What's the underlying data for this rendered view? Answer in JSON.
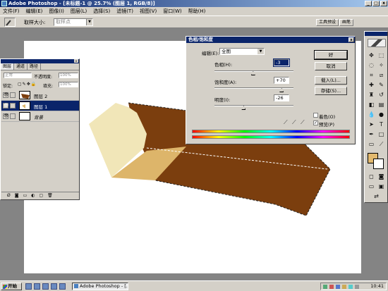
{
  "window": {
    "title": "Adobe Photoshop - [未标题-1 @ 25.7% (图层 1, RGB/8)]"
  },
  "menu": [
    "文件(F)",
    "编辑(E)",
    "图像(I)",
    "图层(L)",
    "选择(S)",
    "滤镜(T)",
    "视图(V)",
    "窗口(W)",
    "帮助(H)"
  ],
  "options": {
    "sample_size_label": "取样大小:",
    "sample_size_value": "取样点",
    "well_tabs": [
      "工具预设",
      "画笔"
    ]
  },
  "layers_panel": {
    "tabs": [
      "图层",
      "通道",
      "路径"
    ],
    "blend_mode": "正常",
    "opacity_label": "不透明度:",
    "opacity_value": "100%",
    "lock_label": "锁定:",
    "fill_label": "填充:",
    "fill_value": "100%",
    "layers": [
      {
        "name": "图层 2",
        "selected": false
      },
      {
        "name": "图层 1",
        "selected": true
      },
      {
        "name": "背景",
        "selected": false
      }
    ]
  },
  "dialog": {
    "title": "色相/饱和度",
    "edit_label": "编辑(E):",
    "edit_value": "全图",
    "hue_label": "色相(H):",
    "hue_value": "-3",
    "saturation_label": "饱和度(A):",
    "saturation_value": "+70",
    "lightness_label": "明度(I):",
    "lightness_value": "-26",
    "buttons": {
      "ok": "好",
      "cancel": "取消",
      "load": "载入(L)...",
      "save": "存储(S)..."
    },
    "colorize_label": "着色(O)",
    "colorize_checked": false,
    "preview_label": "预览(P)",
    "preview_checked": true,
    "slider_fractions": {
      "hue": 0.49,
      "saturation": 0.85,
      "lightness": 0.37
    }
  },
  "colors": {
    "foreground": "#e2b96e",
    "background": "#ffffff",
    "dark_brown": "#7b3e0e",
    "light_cream": "#f1e6b8",
    "tan": "#ddb56a"
  },
  "taskbar": {
    "start_label": "开始",
    "task_label": "Adobe Photoshop - [...",
    "clock": "10:41"
  }
}
